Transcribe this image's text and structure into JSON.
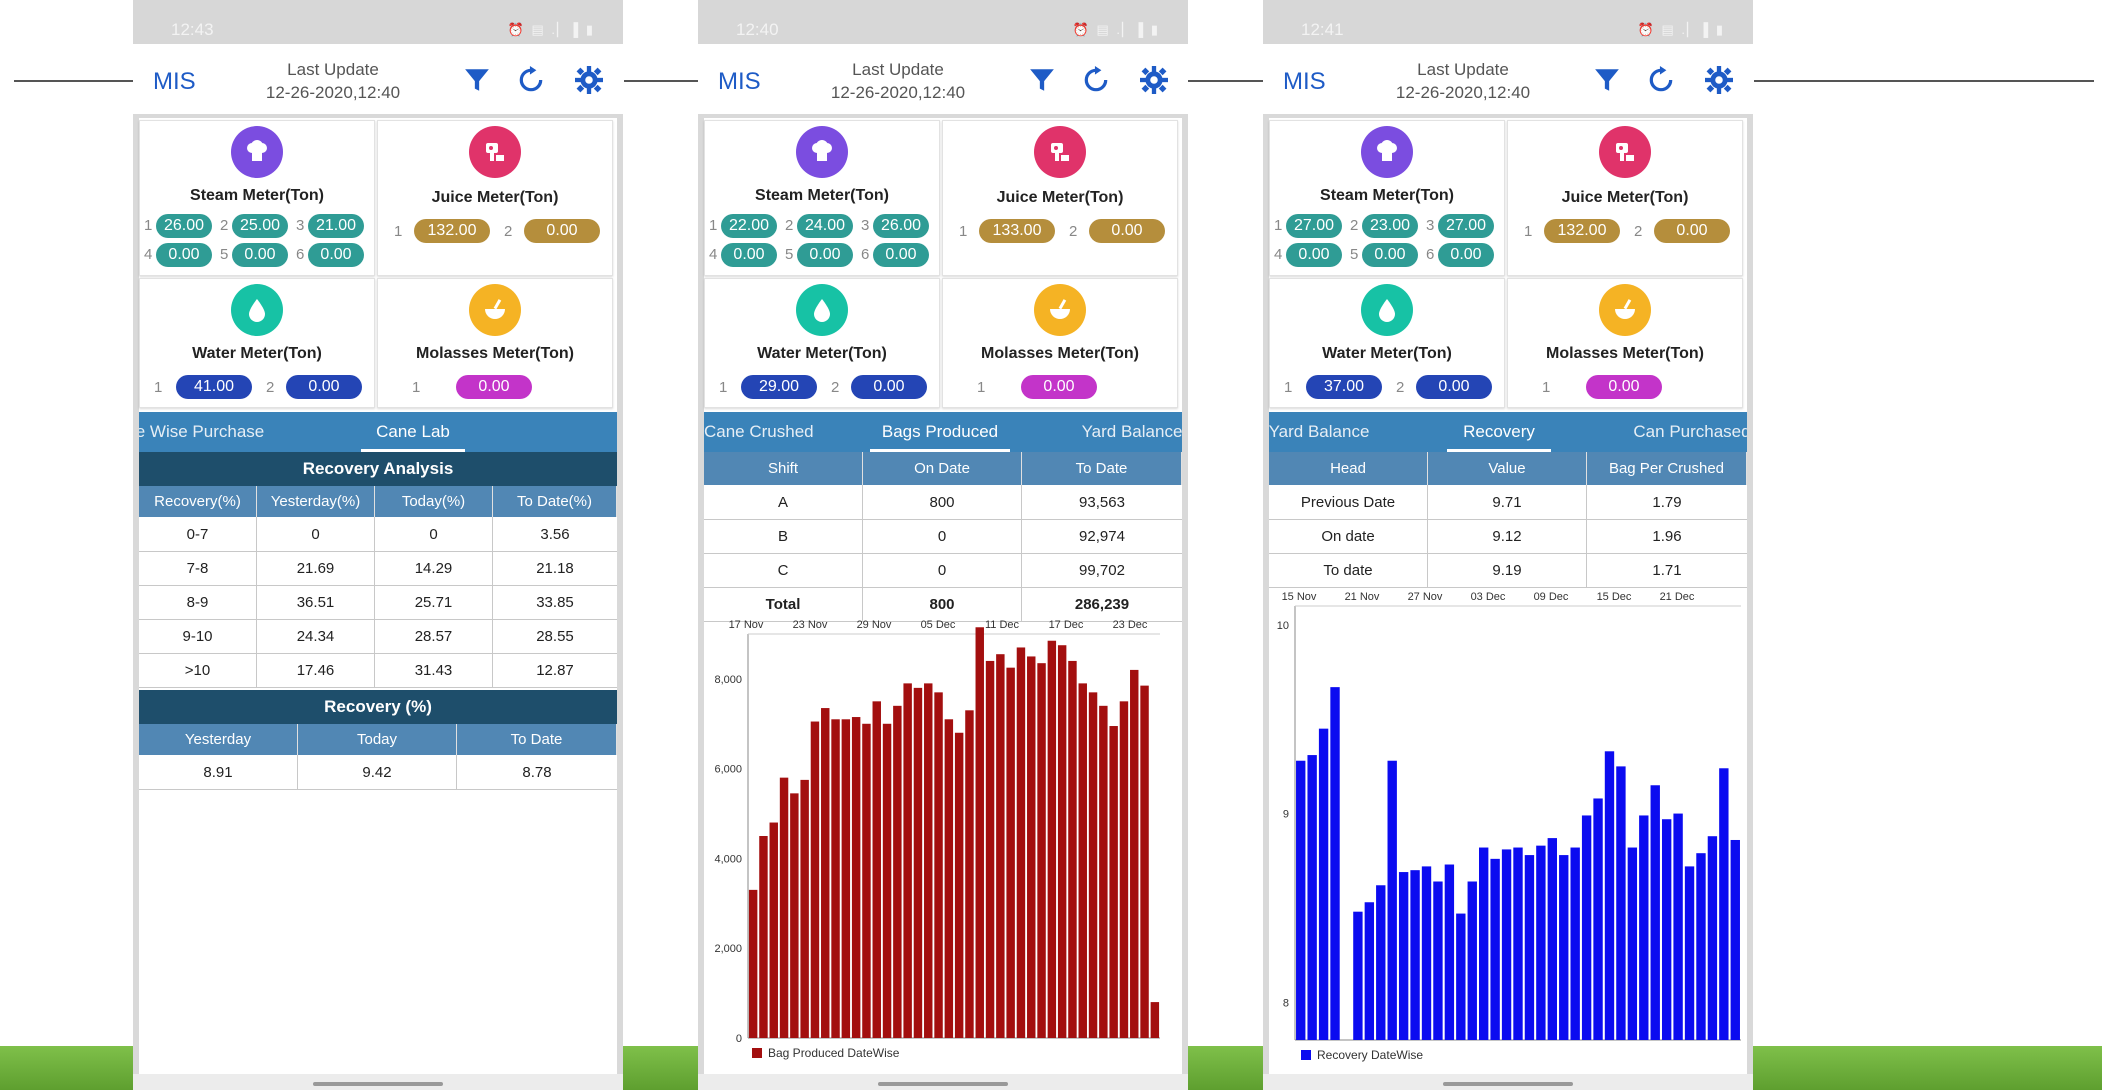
{
  "colors": {
    "blue": "#1e5bc6",
    "teal": "#2f9c95",
    "gold": "#b58e3c",
    "navy": "#2445b5",
    "magenta": "#c334c9",
    "maroon": "#a30f0f",
    "bars_blue": "#0b0bf0",
    "tab_bg": "#3a83b9",
    "header_bg": "#5187b4",
    "dark_header": "#1e4e6b"
  },
  "icons": {
    "filter": "filter-icon",
    "refresh": "refresh-icon",
    "settings": "gear-icon",
    "steam": "chef-hat-icon",
    "juice": "juicer-icon",
    "water": "droplet-icon",
    "molasses": "bowl-icon"
  },
  "labels": {
    "app": "MIS",
    "last_update": "Last Update",
    "steam": "Steam Meter(Ton)",
    "juice": "Juice Meter(Ton)",
    "water": "Water Meter(Ton)",
    "molasses": "Molasses Meter(Ton)"
  },
  "screens": [
    {
      "status_time": "12:43",
      "last_update_value": "12-26-2020,12:40",
      "steam": {
        "values": [
          "26.00",
          "25.00",
          "21.00",
          "0.00",
          "0.00",
          "0.00"
        ]
      },
      "juice": {
        "values": [
          "132.00",
          "0.00"
        ]
      },
      "water": {
        "values": [
          "41.00",
          "0.00"
        ]
      },
      "molasses": {
        "values": [
          "0.00"
        ]
      },
      "tabs": [
        "e Wise Purchase",
        "Cane Lab"
      ],
      "recovery_analysis": {
        "title": "Recovery Analysis",
        "headers": [
          "Recovery(%)",
          "Yesterday(%)",
          "Today(%)",
          "To Date(%)"
        ],
        "rows": [
          [
            "0-7",
            "0",
            "0",
            "3.56"
          ],
          [
            "7-8",
            "21.69",
            "14.29",
            "21.18"
          ],
          [
            "8-9",
            "36.51",
            "25.71",
            "33.85"
          ],
          [
            "9-10",
            "24.34",
            "28.57",
            "28.55"
          ],
          [
            ">10",
            "17.46",
            "31.43",
            "12.87"
          ]
        ]
      },
      "recovery_pct": {
        "title": "Recovery (%)",
        "headers": [
          "Yesterday",
          "Today",
          "To Date"
        ],
        "rows": [
          [
            "8.91",
            "9.42",
            "8.78"
          ]
        ]
      }
    },
    {
      "status_time": "12:40",
      "last_update_value": "12-26-2020,12:40",
      "steam": {
        "values": [
          "22.00",
          "24.00",
          "26.00",
          "0.00",
          "0.00",
          "0.00"
        ]
      },
      "juice": {
        "values": [
          "133.00",
          "0.00"
        ]
      },
      "water": {
        "values": [
          "29.00",
          "0.00"
        ]
      },
      "molasses": {
        "values": [
          "0.00"
        ]
      },
      "tabs": [
        "Cane Crushed",
        "Bags Produced",
        "Yard Balance"
      ],
      "table": {
        "headers": [
          "Shift",
          "On Date",
          "To Date"
        ],
        "rows": [
          [
            "A",
            "800",
            "93,563"
          ],
          [
            "B",
            "0",
            "92,974"
          ],
          [
            "C",
            "0",
            "99,702"
          ],
          [
            "Total",
            "800",
            "286,239"
          ]
        ]
      }
    },
    {
      "status_time": "12:41",
      "last_update_value": "12-26-2020,12:40",
      "steam": {
        "values": [
          "27.00",
          "23.00",
          "27.00",
          "0.00",
          "0.00",
          "0.00"
        ]
      },
      "juice": {
        "values": [
          "132.00",
          "0.00"
        ]
      },
      "water": {
        "values": [
          "37.00",
          "0.00"
        ]
      },
      "molasses": {
        "values": [
          "0.00"
        ]
      },
      "tabs": [
        "Yard Balance",
        "Recovery",
        "Can Purchased"
      ],
      "table": {
        "headers": [
          "Head",
          "Value",
          "Bag Per Crushed"
        ],
        "rows": [
          [
            "Previous Date",
            "9.71",
            "1.79"
          ],
          [
            "On date",
            "9.12",
            "1.96"
          ],
          [
            "To date",
            "9.19",
            "1.71"
          ]
        ]
      }
    }
  ],
  "chart_data": [
    {
      "type": "bar",
      "x_ticks": [
        "17 Nov",
        "23 Nov",
        "29 Nov",
        "05 Dec",
        "11 Dec",
        "17 Dec",
        "23 Dec"
      ],
      "y_ticks": [
        "0",
        "2,000",
        "4,000",
        "6,000",
        "8,000"
      ],
      "ylim": [
        0,
        9000
      ],
      "grid": false,
      "legend_position": "bottom-left",
      "series": [
        {
          "name": "Bag Produced DateWise",
          "values": [
            3300,
            4500,
            4800,
            5800,
            5450,
            5750,
            7050,
            7350,
            7100,
            7100,
            7150,
            7000,
            7500,
            7000,
            7400,
            7900,
            7800,
            7900,
            7700,
            7100,
            6800,
            7300,
            9150,
            8400,
            8550,
            8250,
            8700,
            8500,
            8350,
            8850,
            8750,
            8400,
            7900,
            7700,
            7400,
            6950,
            7500,
            8200,
            7850,
            800
          ]
        }
      ]
    },
    {
      "type": "bar",
      "x_ticks": [
        "15 Nov",
        "21 Nov",
        "27 Nov",
        "03 Dec",
        "09 Dec",
        "15 Dec",
        "21 Dec"
      ],
      "y_ticks": [
        "8",
        "9",
        "10"
      ],
      "ylim": [
        7.8,
        10.1
      ],
      "grid": false,
      "legend_position": "bottom-left",
      "series": [
        {
          "name": "Recovery DateWise",
          "values": [
            9.28,
            9.31,
            9.45,
            9.67,
            7.78,
            8.48,
            8.53,
            8.62,
            9.28,
            8.69,
            8.7,
            8.72,
            8.64,
            8.73,
            8.47,
            8.64,
            8.82,
            8.76,
            8.81,
            8.82,
            8.78,
            8.83,
            8.87,
            8.78,
            8.82,
            8.99,
            9.08,
            9.33,
            9.25,
            8.82,
            8.99,
            9.15,
            8.97,
            9.0,
            8.72,
            8.79,
            8.88,
            9.24,
            8.86
          ]
        }
      ]
    }
  ]
}
